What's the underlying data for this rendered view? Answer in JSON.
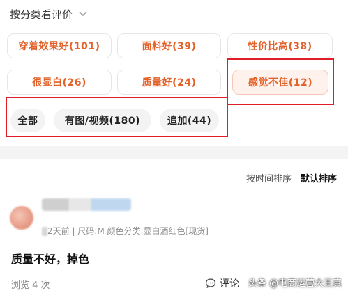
{
  "header": {
    "title": "按分类看评价",
    "chevron_icon": "chevron-down-icon"
  },
  "tags": [
    {
      "label": "穿着效果好(101)",
      "selected": false
    },
    {
      "label": "面料好(39)",
      "selected": false
    },
    {
      "label": "性价比高(38)",
      "selected": false
    },
    {
      "label": "很显白(26)",
      "selected": false
    },
    {
      "label": "质量好(24)",
      "selected": false
    },
    {
      "label": "感觉不佳(12)",
      "selected": true
    }
  ],
  "filters": [
    {
      "label": "全部"
    },
    {
      "label": "有图/视频(180)"
    },
    {
      "label": "追加(44)"
    }
  ],
  "sort": {
    "by_time": "按时间排序",
    "default": "默认排序",
    "active": "default"
  },
  "review": {
    "meta": "2天前 | 尺码:M 颜色分类:显白酒红色[现货]",
    "text": "质量不好，掉色",
    "views": "浏览 4 次",
    "comment_label": "评论"
  },
  "watermark": "头条 @电商运营大王真",
  "colors": {
    "accent": "#e2622a",
    "highlight_box": "#e01e2a",
    "selected_bg": "#fff1ec"
  }
}
